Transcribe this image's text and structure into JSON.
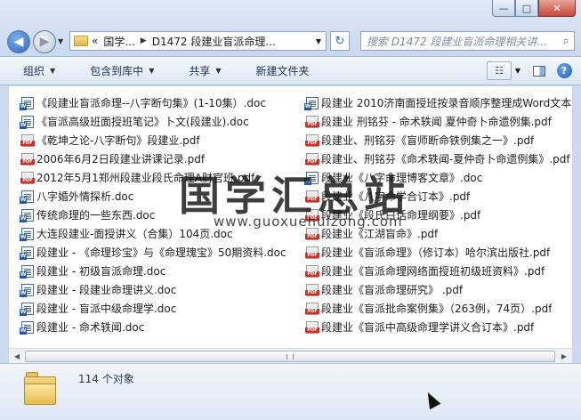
{
  "window": {
    "minimize": "—",
    "maximize": "□",
    "close": "✕"
  },
  "address": {
    "prefix": "«",
    "crumb1": "国学...",
    "crumb2": "D1472 段建业盲派命理..."
  },
  "search": {
    "placeholder": "搜索 D1472 段建业盲派命理相关讲..."
  },
  "toolbar": {
    "organize": "组织",
    "include_in_library": "包含到库中",
    "share": "共享",
    "new_folder": "新建文件夹"
  },
  "files_col1": [
    {
      "type": "doc",
      "name": "《段建业盲派命理--八字断句集》(1-10集）.doc"
    },
    {
      "type": "doc",
      "name": "《盲派高级班面授班笔记》卜文(段建业).doc"
    },
    {
      "type": "pdf",
      "name": "《乾坤之论-八字断句》段建业.pdf"
    },
    {
      "type": "pdf",
      "name": "2006年6月2日段建业讲课记录.pdf"
    },
    {
      "type": "pdf",
      "name": "2012年5月1郑州段建业段氏命理A财官班.pdf"
    },
    {
      "type": "doc",
      "name": "八字婚外情探析.doc"
    },
    {
      "type": "doc",
      "name": "传统命理的一些东西.doc"
    },
    {
      "type": "doc",
      "name": "大连段建业-面授讲义（合集）104页.doc"
    },
    {
      "type": "doc",
      "name": "段建业 - 《命理珍宝》与《命理瑰宝》50期资料.doc"
    },
    {
      "type": "doc",
      "name": "段建业 - 初级盲派命理.doc"
    },
    {
      "type": "doc",
      "name": "段建业 - 段建业命理讲义.doc"
    },
    {
      "type": "doc",
      "name": "段建业 - 盲派中级命理学.doc"
    },
    {
      "type": "doc",
      "name": "段建业 - 命术轶闻.doc"
    }
  ],
  "files_col2": [
    {
      "type": "doc",
      "name": "段建业 2010济南面授班按录音顺序整理成Word文本"
    },
    {
      "type": "pdf",
      "name": "段建业 刑铭芬 - 命术轶闻 夏仲奇卜命遗例集.pdf"
    },
    {
      "type": "pdf",
      "name": "段建业、刑铭芬《盲师断命铁例集之一》.pdf"
    },
    {
      "type": "pdf",
      "name": "段建业、刑铭芬《命术轶闻-夏仲奇卜命遗例集》.pdf"
    },
    {
      "type": "doc",
      "name": "段建业《八字命理博客文章》.doc"
    },
    {
      "type": "pdf",
      "name": "段建业《八字命学合订本》.pdf"
    },
    {
      "type": "pdf",
      "name": "段建业《段氏白话命理纲要》.pdf"
    },
    {
      "type": "pdf",
      "name": "段建业《江湖盲命》.pdf"
    },
    {
      "type": "pdf",
      "name": "段建业《盲派命理》（修订本）哈尔滨出版社.pdf"
    },
    {
      "type": "pdf",
      "name": "段建业《盲派命理网络面授班初级班资料》.pdf"
    },
    {
      "type": "pdf",
      "name": "段建业《盲派命理研究》 .pdf"
    },
    {
      "type": "pdf",
      "name": "段建业《盲派批命案例集》（263例，74页）.pdf"
    },
    {
      "type": "pdf",
      "name": "段建业《盲派中高级命理学讲义合订本》.pdf"
    }
  ],
  "watermark": {
    "title": "国学汇总站",
    "url": "www.guoxuehuizong.com"
  },
  "status": {
    "count": "114 个对象"
  },
  "icons": {
    "back": "back-arrow-icon",
    "forward": "forward-arrow-icon",
    "refresh": "refresh-icon",
    "search": "search-icon",
    "help": "help-icon"
  }
}
